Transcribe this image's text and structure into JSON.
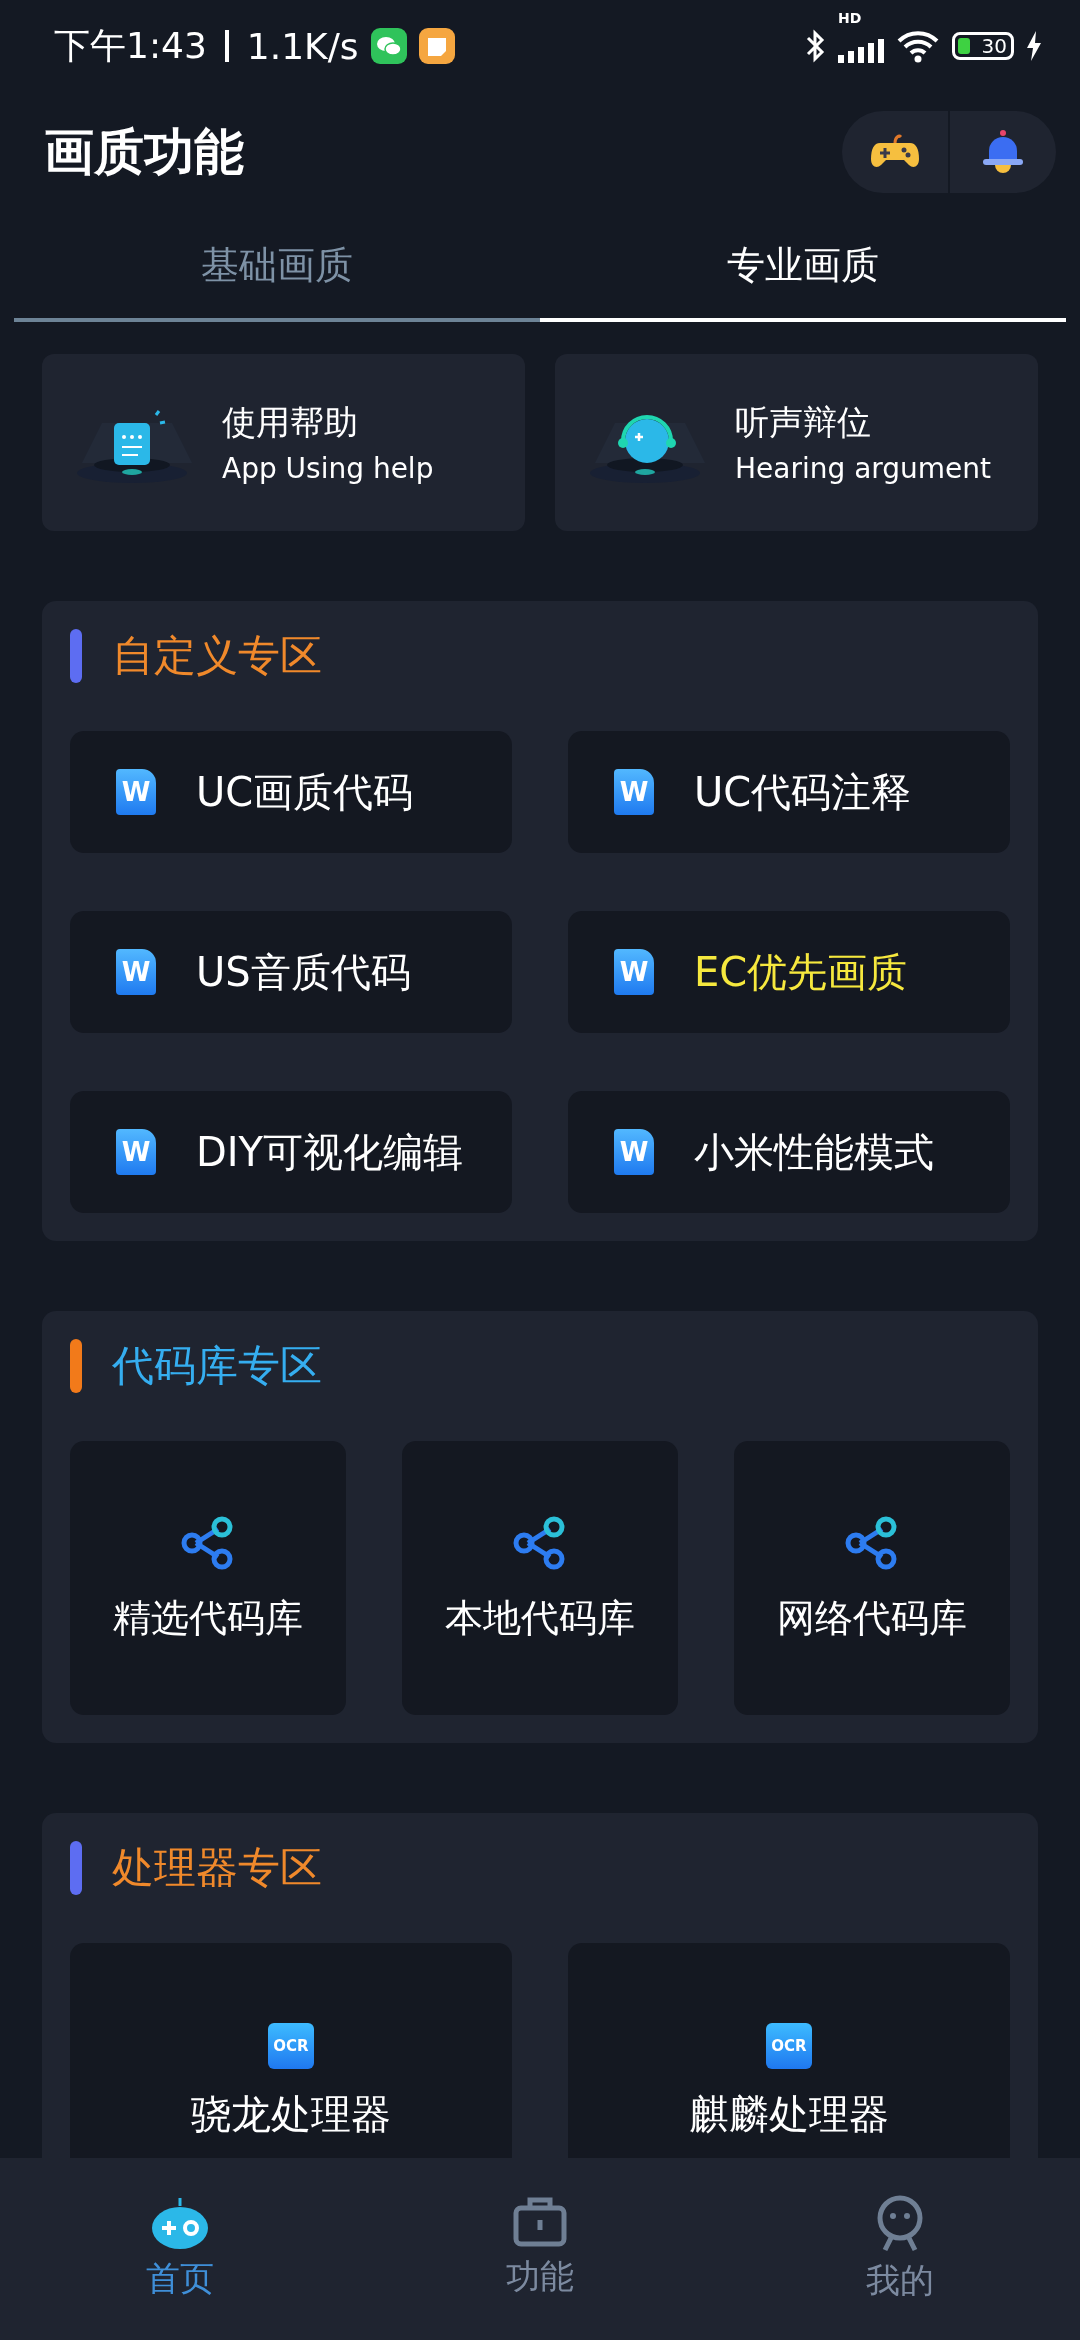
{
  "status_bar": {
    "time": "下午1:43",
    "speed": "1.1K/s",
    "network": "HD",
    "battery": "30"
  },
  "header": {
    "title": "画质功能"
  },
  "tabs": [
    {
      "label": "基础画质",
      "selected": false
    },
    {
      "label": "专业画质",
      "selected": true
    }
  ],
  "help_cards": [
    {
      "kind": "doc",
      "title": "使用帮助",
      "subtitle": "App Using help"
    },
    {
      "kind": "headset",
      "title": "听声辩位",
      "subtitle": "Hearing argument"
    }
  ],
  "sections": [
    {
      "title": "自定义专区",
      "color": "#f0892b",
      "marker": {
        "color": "#5d6df2"
      },
      "kind": "doc",
      "items": [
        {
          "label": "UC画质代码",
          "icon_text": "W",
          "highlighted": false
        },
        {
          "label": "UC代码注释",
          "icon_text": "W",
          "highlighted": false
        },
        {
          "label": "US音质代码",
          "icon_text": "W",
          "highlighted": false
        },
        {
          "label": "EC优先画质",
          "icon_text": "W",
          "highlighted": true
        },
        {
          "label": "DIY可视化编辑",
          "icon_text": "W",
          "highlighted": false
        },
        {
          "label": "小米性能模式",
          "icon_text": "W",
          "highlighted": false
        }
      ]
    },
    {
      "title": "代码库专区",
      "color": "#35aef0",
      "marker": {
        "color": "#f27a1a"
      },
      "kind": "share",
      "items": [
        {
          "label": "精选代码库"
        },
        {
          "label": "本地代码库"
        },
        {
          "label": "网络代码库"
        }
      ]
    },
    {
      "title": "处理器专区",
      "color": "#f0892b",
      "marker": {
        "color": "#5d6df2"
      },
      "kind": "ocr",
      "items": [
        {
          "label": "骁龙处理器",
          "icon_text": "OCR"
        },
        {
          "label": "麒麟处理器",
          "icon_text": "OCR"
        }
      ]
    }
  ],
  "bottom_nav": [
    {
      "label": "首页",
      "kind": "home",
      "selected": true
    },
    {
      "label": "功能",
      "kind": "briefcase",
      "selected": false
    },
    {
      "label": "我的",
      "kind": "person",
      "selected": false
    }
  ]
}
